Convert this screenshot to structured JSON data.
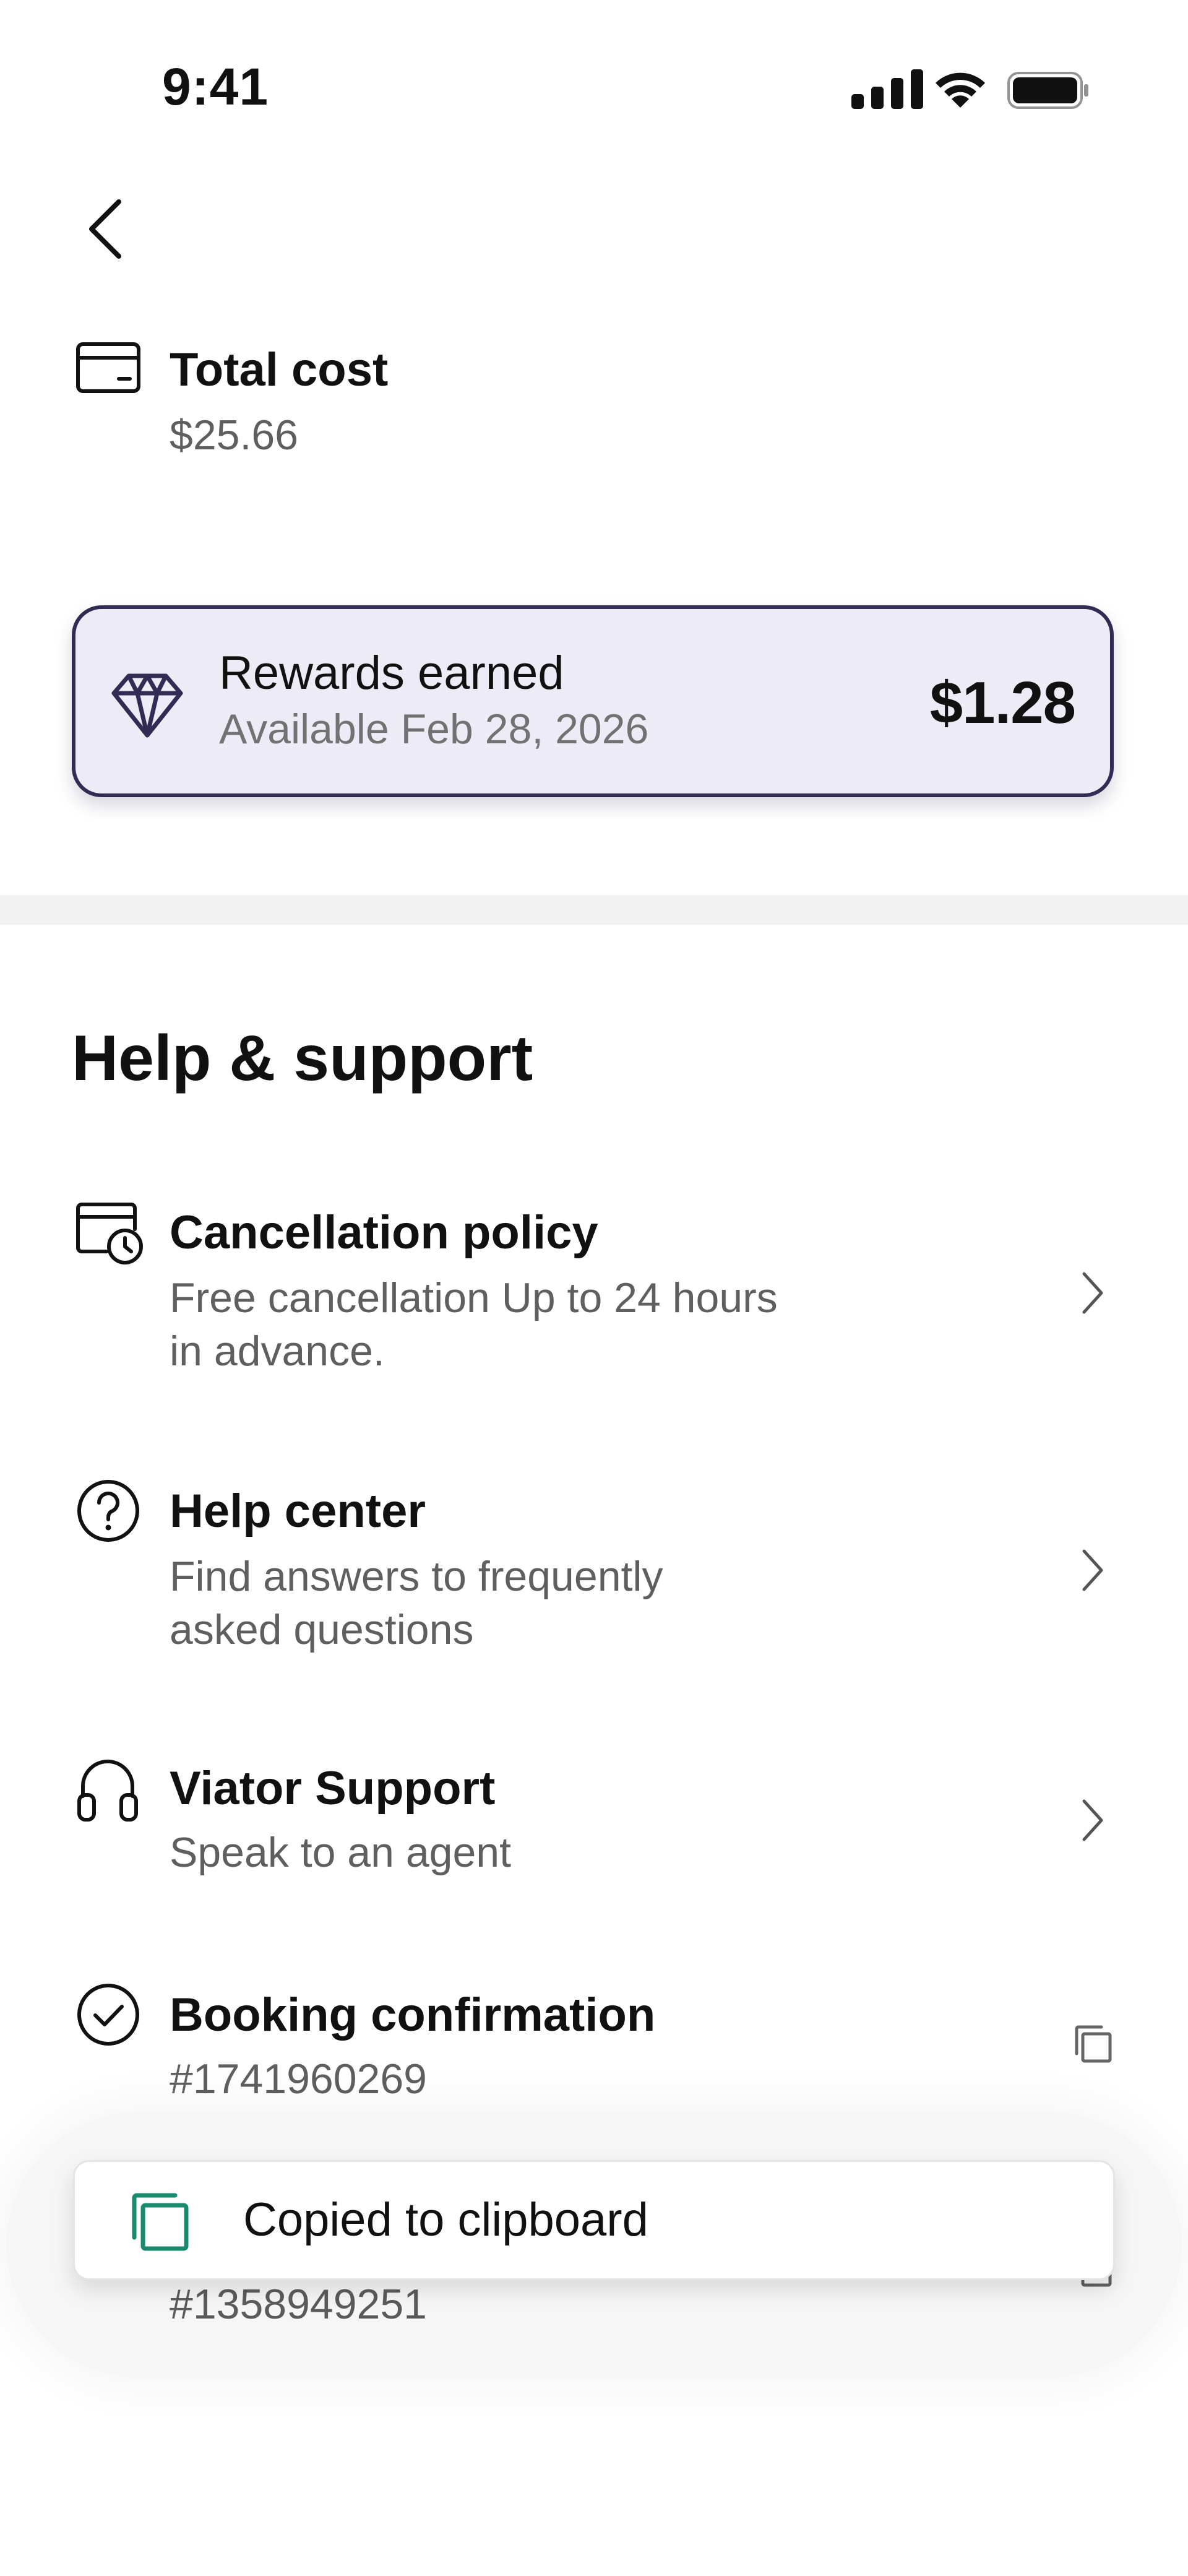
{
  "status_bar": {
    "time": "9:41",
    "icons": [
      "cellular-signal-icon",
      "wifi-icon",
      "battery-icon"
    ]
  },
  "nav": {
    "back_icon": "chevron-left-icon"
  },
  "total_cost": {
    "icon": "credit-card-icon",
    "title": "Total cost",
    "value": "$25.66"
  },
  "rewards": {
    "icon": "diamond-icon",
    "title": "Rewards earned",
    "subtitle": "Available Feb 28, 2026",
    "amount": "$1.28",
    "background_color": "#ecebf6",
    "border_color": "#322c54"
  },
  "help_support": {
    "title": "Help & support",
    "items": [
      {
        "icon": "calendar-clock-icon",
        "title": "Cancellation policy",
        "subtitle_lines": [
          "Free cancellation Up to 24 hours",
          "in advance."
        ],
        "action_icon": "chevron-right-icon"
      },
      {
        "icon": "question-circle-icon",
        "title": "Help center",
        "subtitle_lines": [
          "Find answers to frequently",
          "asked questions"
        ],
        "action_icon": "chevron-right-icon"
      },
      {
        "icon": "headphones-icon",
        "title": "Viator Support",
        "subtitle_lines": [
          "Speak to an agent"
        ],
        "action_icon": "chevron-right-icon"
      },
      {
        "icon": "check-circle-icon",
        "title": "Booking confirmation",
        "subtitle_lines": [
          "#1741960269"
        ],
        "action_icon": "copy-icon"
      }
    ],
    "partially_hidden_item": {
      "subtitle": "#1358949251",
      "action_icon": "copy-icon"
    }
  },
  "toast": {
    "icon": "copy-icon",
    "text": "Copied to clipboard",
    "icon_color": "#1a8a6e"
  }
}
